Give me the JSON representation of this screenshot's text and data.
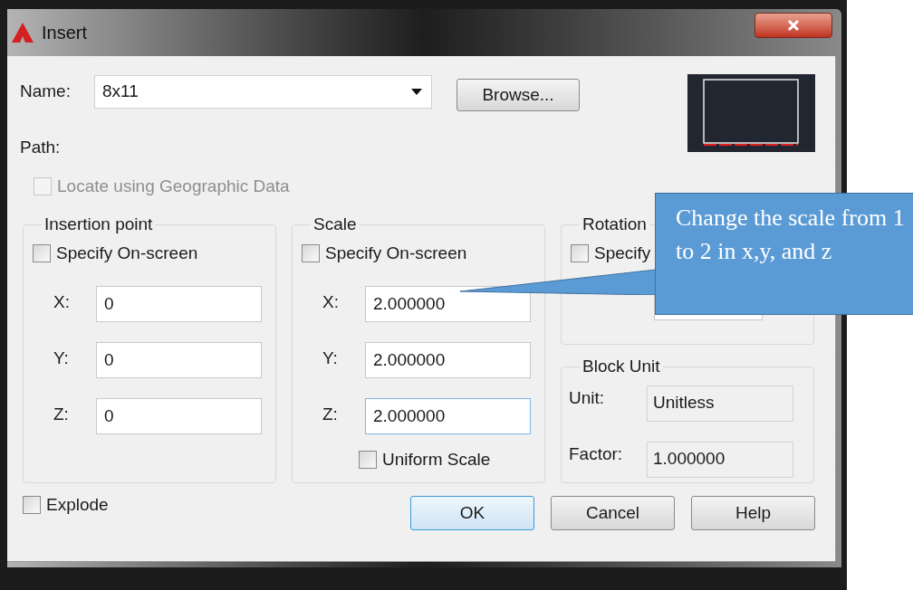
{
  "window": {
    "title": "Insert"
  },
  "name": {
    "label": "Name:",
    "value": "8x11"
  },
  "browse_button": {
    "label": "Browse..."
  },
  "path": {
    "label": "Path:"
  },
  "geographic": {
    "label": "Locate using Geographic Data",
    "checked": false,
    "disabled": true
  },
  "insertion_point": {
    "title": "Insertion point",
    "specify": {
      "label": "Specify On-screen",
      "checked": false
    },
    "fields": [
      {
        "label": "X:",
        "value": "0",
        "focused": false
      },
      {
        "label": "Y:",
        "value": "0",
        "focused": false
      },
      {
        "label": "Z:",
        "value": "0",
        "focused": false
      }
    ]
  },
  "scale": {
    "title": "Scale",
    "specify": {
      "label": "Specify On-screen",
      "checked": false
    },
    "fields": [
      {
        "label": "X:",
        "value": "2.000000",
        "focused": false
      },
      {
        "label": "Y:",
        "value": "2.000000",
        "focused": false
      },
      {
        "label": "Z:",
        "value": "2.000000",
        "focused": true
      }
    ],
    "uniform": {
      "label": "Uniform Scale",
      "checked": false
    }
  },
  "rotation": {
    "title": "Rotation",
    "specify": {
      "label": "Specify",
      "checked": false
    }
  },
  "block_unit": {
    "title": "Block Unit",
    "fields": [
      {
        "label": "Unit:",
        "value": "Unitless"
      },
      {
        "label": "Factor:",
        "value": "1.000000"
      }
    ]
  },
  "explode": {
    "label": "Explode",
    "checked": false
  },
  "buttons": [
    {
      "label": "OK",
      "default": true
    },
    {
      "label": "Cancel",
      "default": false
    },
    {
      "label": "Help",
      "default": false
    }
  ],
  "callout": {
    "text": "Change the scale from 1 to 2 in x,y, and z"
  }
}
